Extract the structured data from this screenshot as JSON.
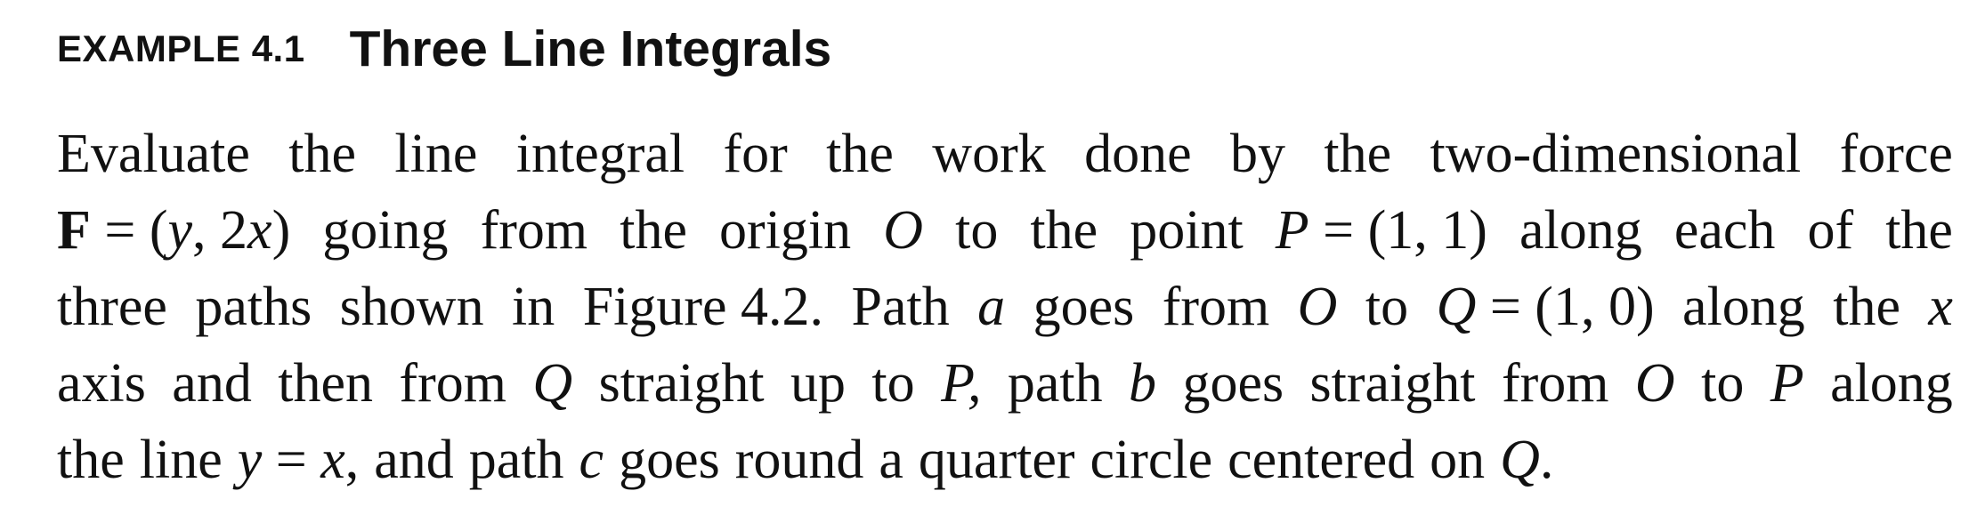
{
  "example": {
    "label": "EXAMPLE 4.1",
    "title": "Three Line Integrals"
  },
  "paragraph": {
    "line1": [
      "Evaluate",
      "the",
      "line",
      "integral",
      "for",
      "the",
      "work",
      "done",
      "by",
      "the",
      "two-dimensional",
      "force"
    ],
    "line2": [
      "F = (y, 2x)",
      "going",
      "from",
      "the",
      "origin",
      "O",
      "to",
      "the",
      "point",
      "P = (1, 1)",
      "along",
      "each",
      "of",
      "the"
    ],
    "line3": [
      "three",
      "paths",
      "shown",
      "in",
      "Figure 4.2.",
      "Path",
      "a",
      "goes",
      "from",
      "O",
      "to",
      "Q = (1, 0)",
      "along",
      "the",
      "x"
    ],
    "line4": [
      "axis",
      "and",
      "then",
      "from",
      "Q",
      "straight",
      "up",
      "to",
      "P,",
      "path",
      "b",
      "goes",
      "straight",
      "from",
      "O",
      "to",
      "P",
      "along"
    ],
    "line5": [
      "the",
      "line",
      "y = x,",
      "and",
      "path",
      "c",
      "goes",
      "round",
      "a",
      "quarter",
      "circle",
      "centered",
      "on",
      "Q."
    ]
  }
}
